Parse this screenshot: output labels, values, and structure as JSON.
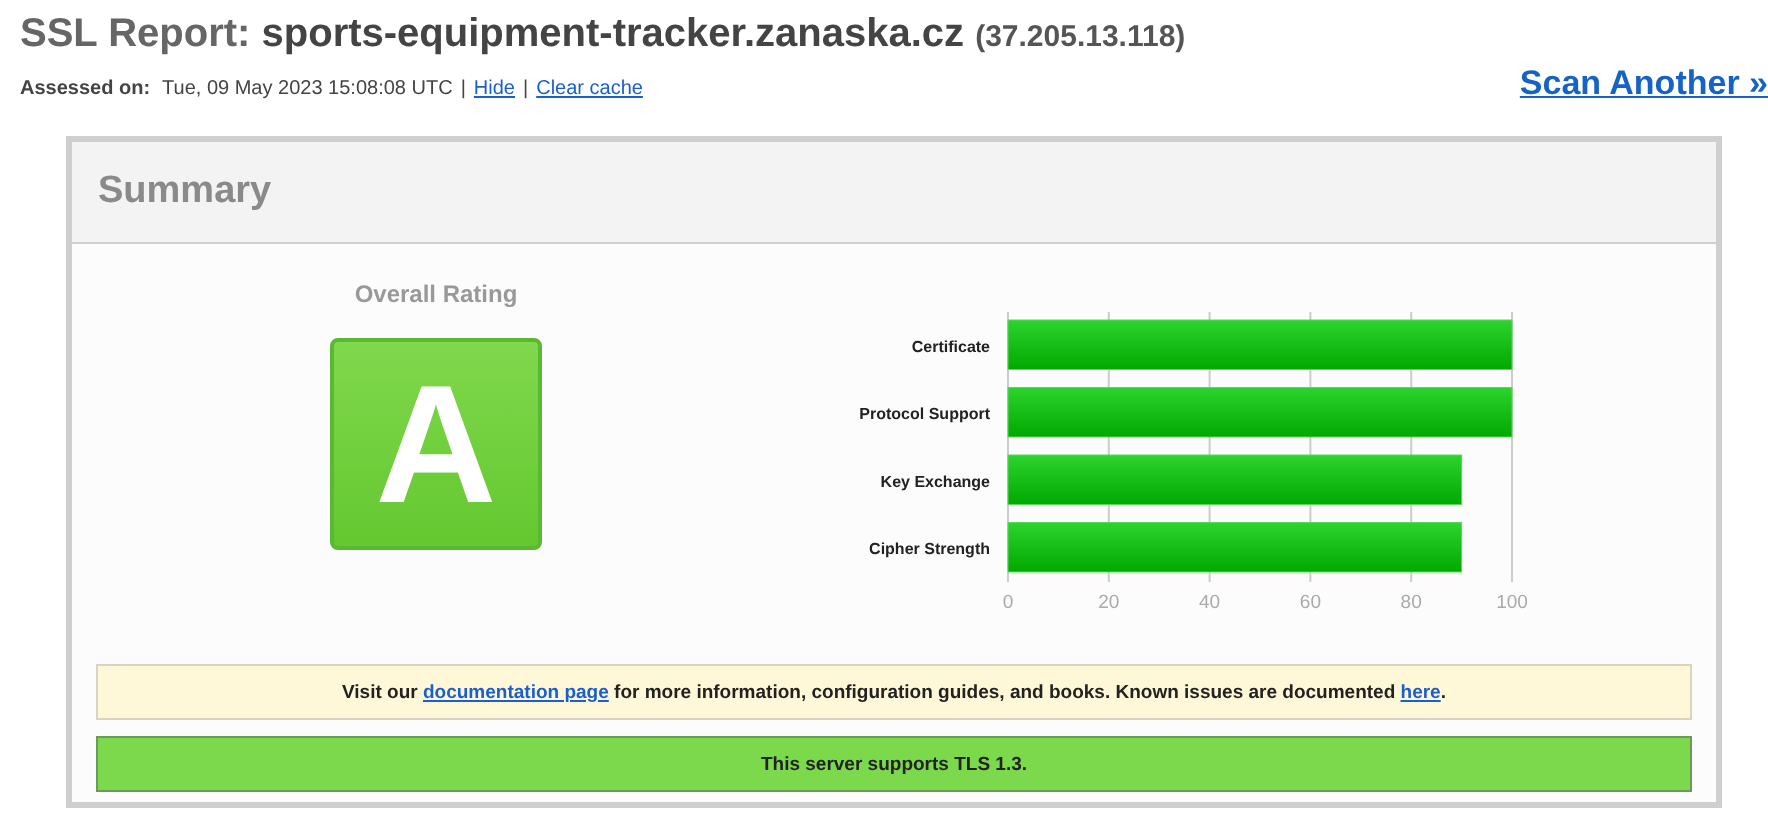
{
  "header": {
    "title_prefix": "SSL Report:",
    "hostname": "sports-equipment-tracker.zanaska.cz",
    "ip": "(37.205.13.118)",
    "assessed_label": "Assessed on:",
    "assessed_date": "Tue, 09 May 2023 15:08:08 UTC",
    "separator_1": "|",
    "hide_link": "Hide",
    "separator_2": "|",
    "clear_cache_link": "Clear cache",
    "scan_another": "Scan Another »"
  },
  "summary": {
    "title": "Summary",
    "rating_label": "Overall Rating",
    "grade": "A",
    "chart_data": {
      "type": "bar",
      "orientation": "horizontal",
      "categories": [
        "Certificate",
        "Protocol Support",
        "Key Exchange",
        "Cipher Strength"
      ],
      "values": [
        100,
        100,
        90,
        90
      ],
      "xlim": [
        0,
        100
      ],
      "xticks": [
        0,
        20,
        40,
        60,
        80,
        100
      ],
      "grid": true
    },
    "notices": [
      {
        "kind": "info",
        "parts": [
          {
            "kind": "text",
            "text": "Visit our "
          },
          {
            "kind": "link",
            "text": "documentation page"
          },
          {
            "kind": "text",
            "text": " for more information, configuration guides, and books. Known issues are documented "
          },
          {
            "kind": "link",
            "text": "here"
          },
          {
            "kind": "text",
            "text": "."
          }
        ]
      },
      {
        "kind": "good",
        "parts": [
          {
            "kind": "text",
            "text": "This server supports TLS 1.3."
          }
        ]
      }
    ]
  }
}
